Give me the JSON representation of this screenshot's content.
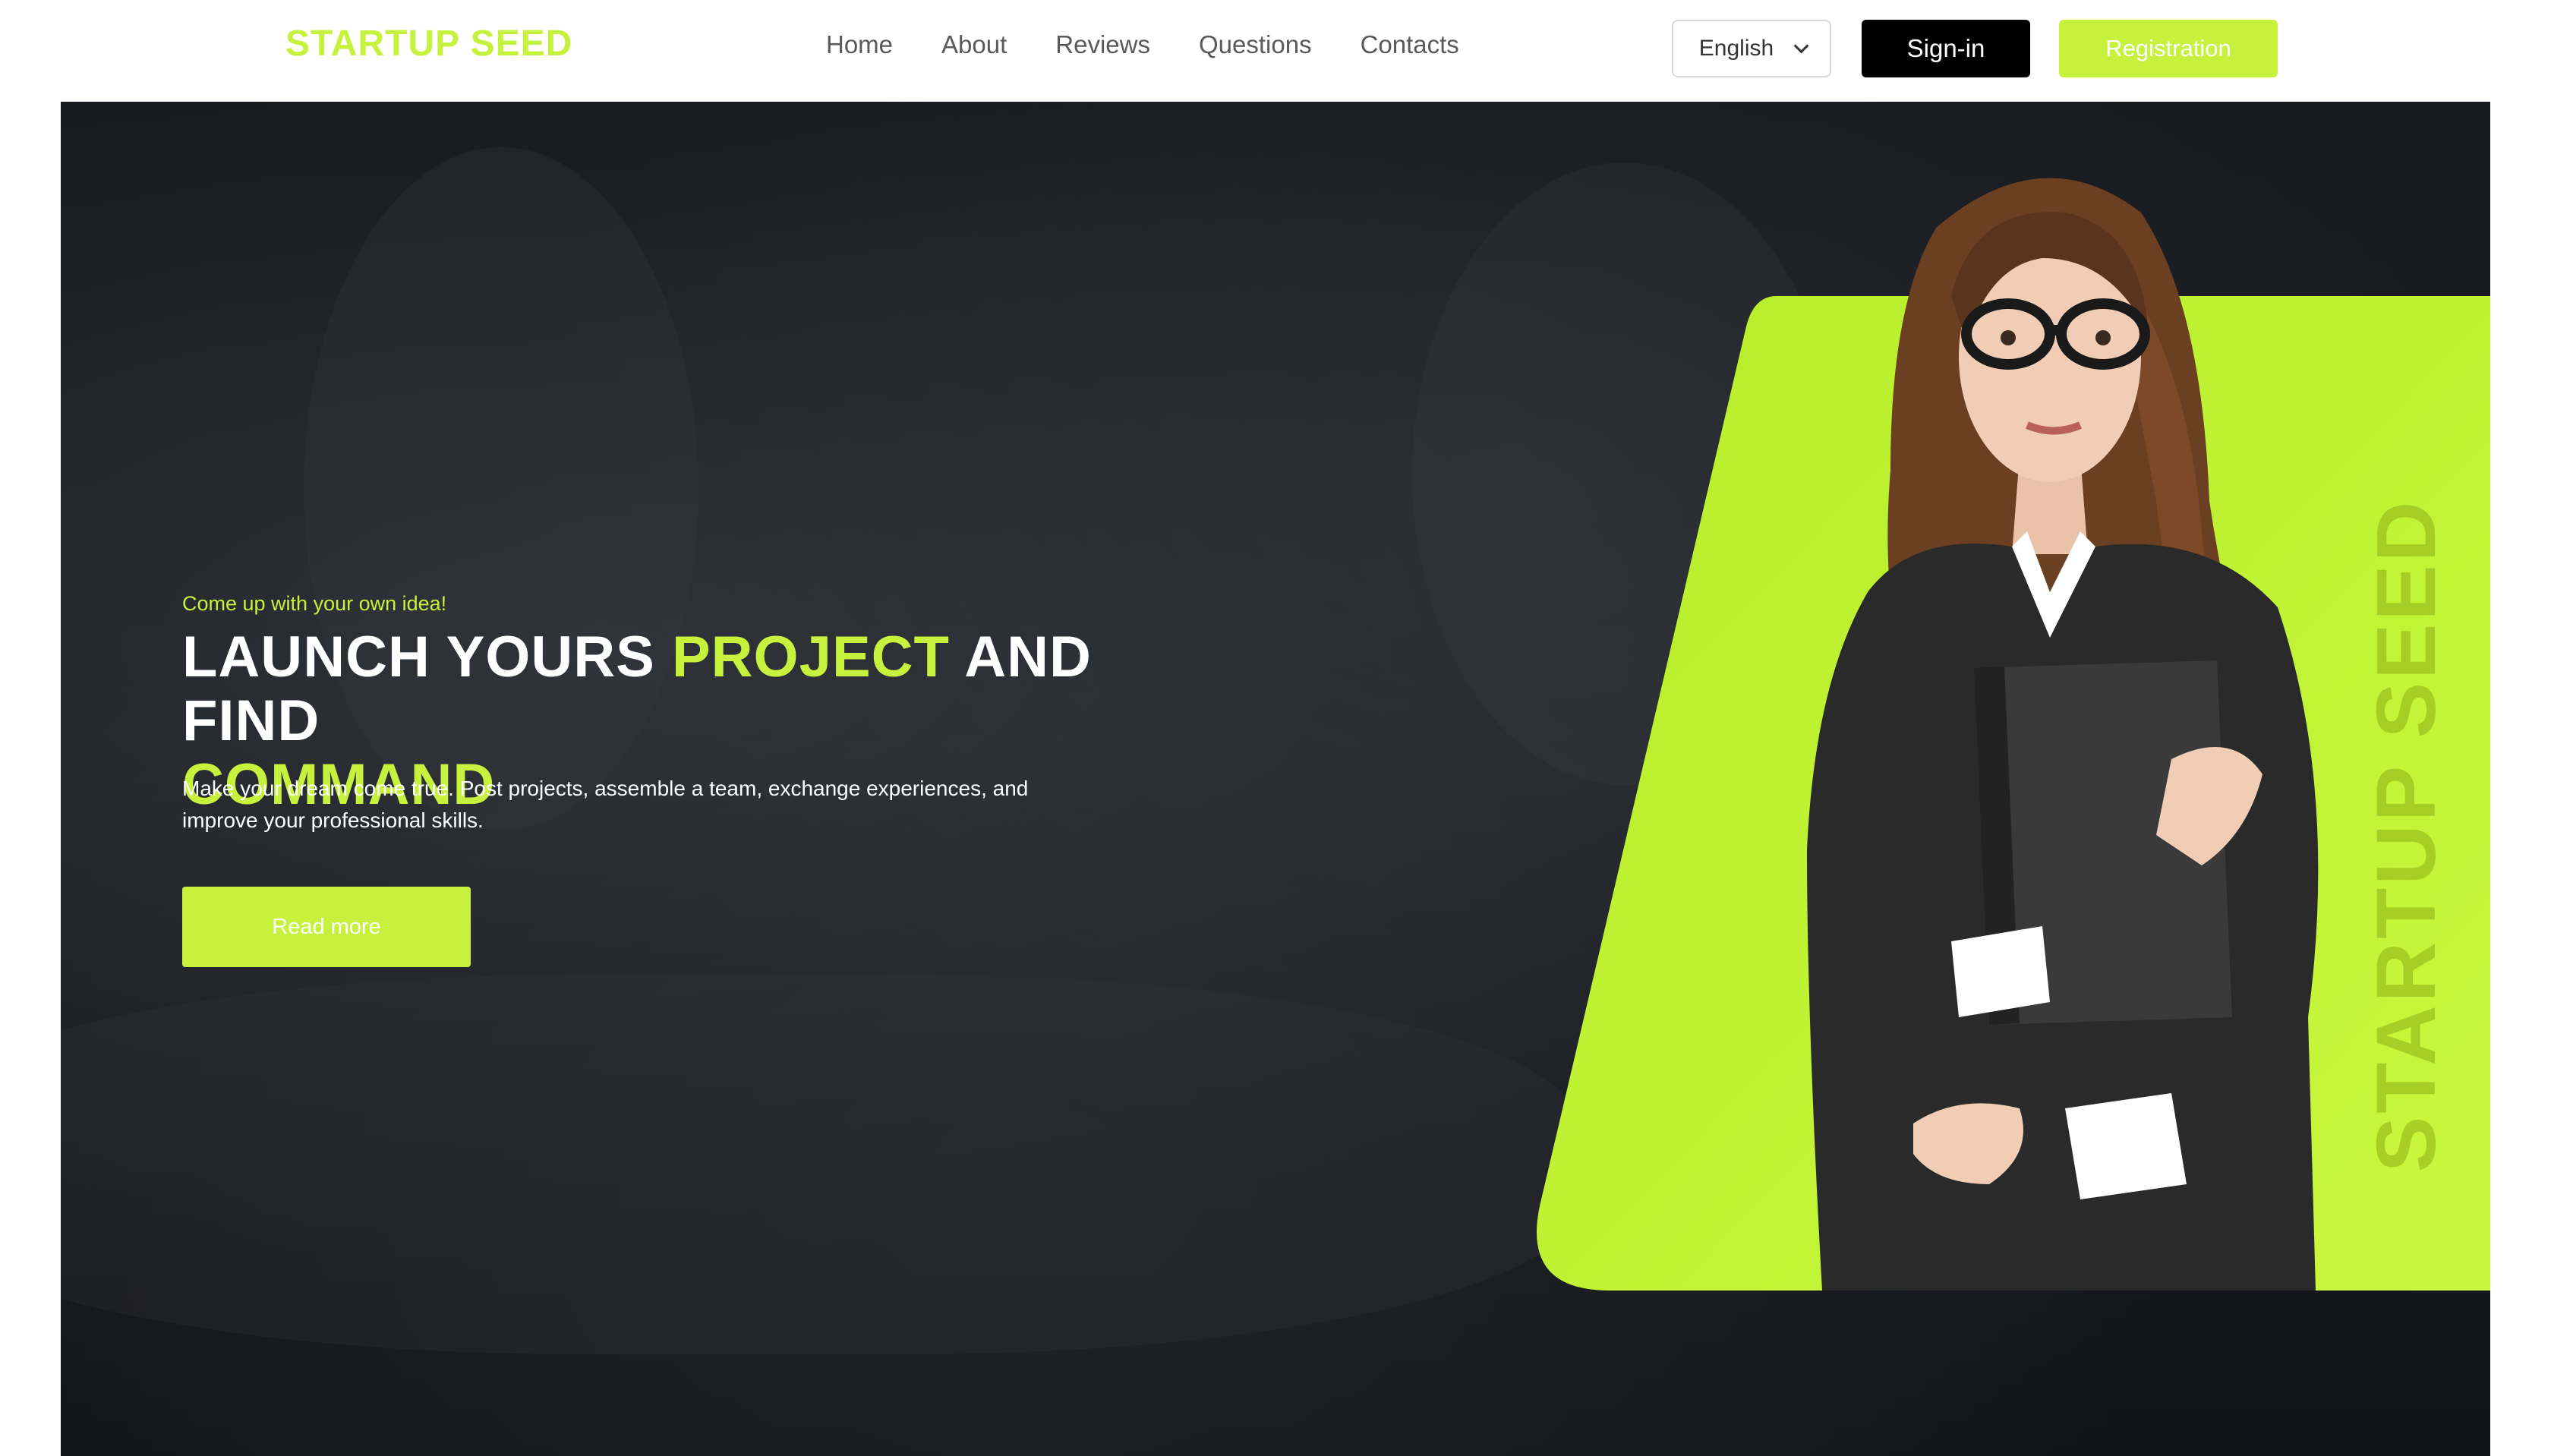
{
  "header": {
    "logo": "STARTUP SEED",
    "nav": [
      "Home",
      "About",
      "Reviews",
      "Questions",
      "Contacts"
    ],
    "language": "English",
    "signin_label": "Sign-in",
    "registration_label": "Registration"
  },
  "hero": {
    "tagline": "Come up with your own idea!",
    "headline_part1": "LAUNCH YOURS ",
    "headline_highlight1": "PROJECT",
    "headline_part2": " AND FIND ",
    "headline_highlight2": "COMMAND",
    "description": "Make your dream come true. Post projects, assemble a team, exchange experiences, and improve your professional skills.",
    "read_more_label": "Read more",
    "vertical_brand": "STARTUP SEED"
  },
  "colors": {
    "accent": "#c6f13c",
    "dark_bg": "#16191d",
    "signin_bg": "#000000"
  },
  "icons": {
    "language_dropdown": "chevron-down-icon"
  }
}
